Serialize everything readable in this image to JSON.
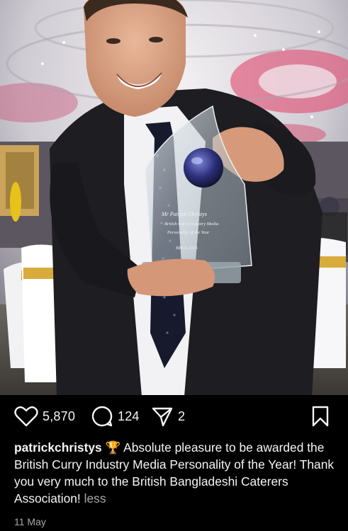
{
  "post": {
    "image_alt": "Man smiling holding a glass award trophy at an awards dinner",
    "trophy": {
      "line1": "Mr Patrick Christys",
      "line2": "British Curry Industry Media",
      "line3": "Personality of the Year",
      "line4": "BBCA 2025"
    },
    "likes_count": "5,870",
    "comments_count": "124",
    "shares_count": "2",
    "username": "patrickchristys",
    "caption_emoji": "🏆",
    "caption_text": "Absolute pleasure to be awarded the British Curry Industry Media Personality of the Year! Thank you very much to the British Bangladeshi Caterers Association!",
    "less_label": "less",
    "date": "11 May"
  },
  "icons": [
    "heart-icon",
    "comment-icon",
    "share-icon",
    "bookmark-icon",
    "trophy-emoji"
  ],
  "colors": {
    "background": "#000000",
    "text": "#f5f5f5",
    "muted": "#a8a8a8"
  }
}
